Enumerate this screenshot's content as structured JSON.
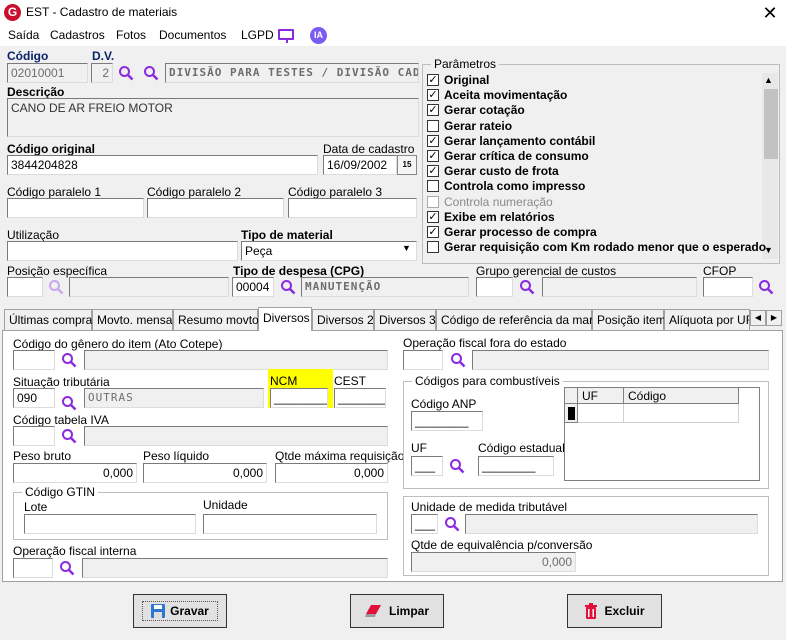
{
  "window": {
    "title": "EST - Cadastro de materiais",
    "logo": "G"
  },
  "menu": [
    "Saída",
    "Cadastros",
    "Fotos",
    "Documentos",
    "LGPD"
  ],
  "menu_ia": "IA",
  "fields": {
    "codigo_label": "Código",
    "codigo": "02010001",
    "dv_label": "D.V.",
    "dv": "2",
    "divisao": "DIVISÃO PARA TESTES / DIVISÃO CADAS",
    "descricao_label": "Descrição",
    "descricao": "CANO DE AR FREIO MOTOR",
    "codigo_original_label": "Código original",
    "codigo_original": "3844204828",
    "data_cadastro_label": "Data de cadastro",
    "data_cadastro": "16/09/2002",
    "cal_day": "15",
    "cod_paralelo1_label": "Código paralelo 1",
    "cod_paralelo2_label": "Código paralelo 2",
    "cod_paralelo3_label": "Código paralelo 3",
    "utilizacao_label": "Utilização",
    "tipo_material_label": "Tipo de material",
    "tipo_material": "Peça",
    "posicao_label": "Posição específica",
    "tipo_despesa_label": "Tipo de despesa (CPG)",
    "tipo_despesa_cod": "00004",
    "tipo_despesa": "MANUTENÇÃO",
    "grupo_label": "Grupo gerencial de custos",
    "cfop_label": "CFOP"
  },
  "parametros": {
    "title": "Parâmetros",
    "items": [
      {
        "label": "Original",
        "checked": true,
        "enabled": true
      },
      {
        "label": "Aceita movimentação",
        "checked": true,
        "enabled": true
      },
      {
        "label": "Gerar cotação",
        "checked": true,
        "enabled": true
      },
      {
        "label": "Gerar rateio",
        "checked": false,
        "enabled": true
      },
      {
        "label": "Gerar lançamento contábil",
        "checked": true,
        "enabled": true
      },
      {
        "label": "Gerar crítica de consumo",
        "checked": true,
        "enabled": true
      },
      {
        "label": "Gerar custo de frota",
        "checked": true,
        "enabled": true
      },
      {
        "label": "Controla como impresso",
        "checked": false,
        "enabled": true
      },
      {
        "label": "Controla numeração",
        "checked": false,
        "enabled": false
      },
      {
        "label": "Exibe em relatórios",
        "checked": true,
        "enabled": true
      },
      {
        "label": "Gerar processo de compra",
        "checked": true,
        "enabled": true
      },
      {
        "label": "Gerar requisição com Km rodado menor que o esperado",
        "checked": false,
        "enabled": true
      }
    ]
  },
  "tabs": [
    "Últimas compras",
    "Movto. mensal",
    "Resumo movto.",
    "Diversos",
    "Diversos 2",
    "Diversos 3",
    "Código de referência da marca",
    "Posição item",
    "Alíquota por UF"
  ],
  "diversos": {
    "genero_label": "Código do gênero do item (Ato Cotepe)",
    "op_fora_label": "Operação fiscal fora do estado",
    "sit_trib_label": "Situação tributária",
    "sit_trib_cod": "090",
    "sit_trib": "OUTRAS",
    "ncm_label": "NCM",
    "ncm": "________",
    "cest_label": "CEST",
    "cest": "________",
    "iva_label": "Código tabela IVA",
    "peso_bruto_label": "Peso bruto",
    "peso_bruto": "0,000",
    "peso_liquido_label": "Peso líquido",
    "peso_liquido": "0,000",
    "qtde_max_label": "Qtde máxima requisição",
    "qtde_max": "0,000",
    "gtin_title": "Código GTIN",
    "lote_label": "Lote",
    "unidade_label": "Unidade",
    "op_interna_label": "Operação fiscal interna",
    "comb_title": "Códigos para combustíveis",
    "anp_label": "Código ANP",
    "anp": "________",
    "uf_label": "UF",
    "uf": "___",
    "cod_est_label": "Código estadual",
    "cod_est": "________",
    "grid_col1": "UF",
    "grid_col2": "Código",
    "un_trib_label": "Unidade de medida tributável",
    "un_trib": "___",
    "qtde_eq_label": "Qtde de equivalência p/conversão",
    "qtde_eq": "0,000"
  },
  "buttons": {
    "gravar": "Gravar",
    "limpar": "Limpar",
    "excluir": "Excluir"
  },
  "colors": {
    "ncm_highlight": "#ffff00",
    "icon_purple": "#8a2be2",
    "ia_badge": "#7b5cf0"
  }
}
